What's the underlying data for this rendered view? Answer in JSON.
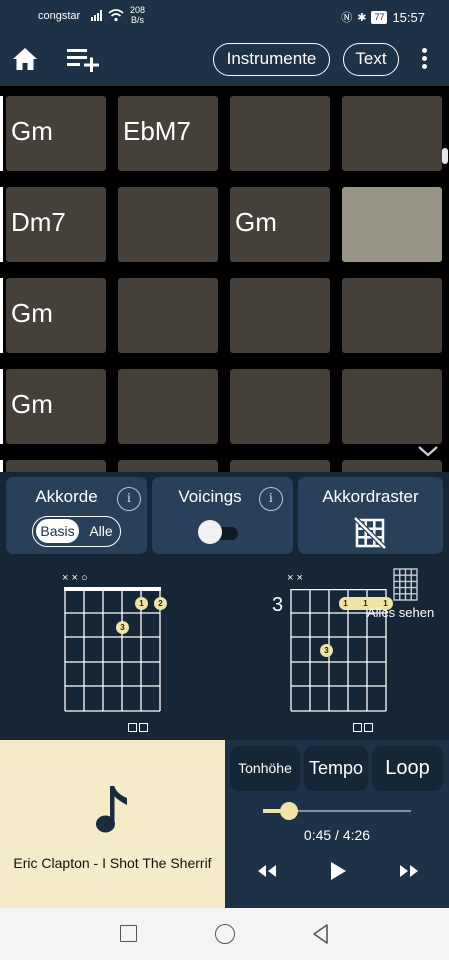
{
  "status_bar": {
    "carrier": "congstar",
    "net_speed_value": "208",
    "net_speed_unit": "B/s",
    "battery": "77",
    "time": "15:57"
  },
  "toolbar": {
    "instruments_label": "Instrumente",
    "text_label": "Text"
  },
  "chord_grid": {
    "rows": [
      [
        "Gm",
        "EbM7",
        "",
        ""
      ],
      [
        "Dm7",
        "",
        "Gm",
        ""
      ],
      [
        "Gm",
        "",
        "",
        ""
      ],
      [
        "Gm",
        "",
        "",
        ""
      ]
    ],
    "highlighted": {
      "row": 1,
      "col": 3
    }
  },
  "controls": {
    "chords_title": "Akkorde",
    "basic_label": "Basis",
    "all_label": "Alle",
    "voicings_title": "Voicings",
    "voicings_enabled": false,
    "chord_grid_title": "Akkordraster",
    "info_glyph": "i"
  },
  "diagrams": {
    "left": {
      "open_strings": "× × ○",
      "fret_start": "",
      "fingers": [
        "1",
        "2",
        "3"
      ]
    },
    "right": {
      "open_strings": "× ×",
      "fret_start": "3",
      "fingers": [
        "1",
        "1",
        "1",
        "3"
      ]
    },
    "see_all_label": "Alles sehen"
  },
  "player": {
    "song_title": "Eric Clapton - I Shot The Sherrif",
    "pitch_label": "Tonhöhe",
    "tempo_label": "Tempo",
    "loop_label": "Loop",
    "time_display": "0:45 / 4:26",
    "progress": 0.176
  },
  "colors": {
    "header_bg": "#1d3147",
    "cell_bg": "#45403a",
    "cell_highlight": "#989587",
    "accent": "#efe3a6",
    "song_bg": "#f6ebc8"
  }
}
